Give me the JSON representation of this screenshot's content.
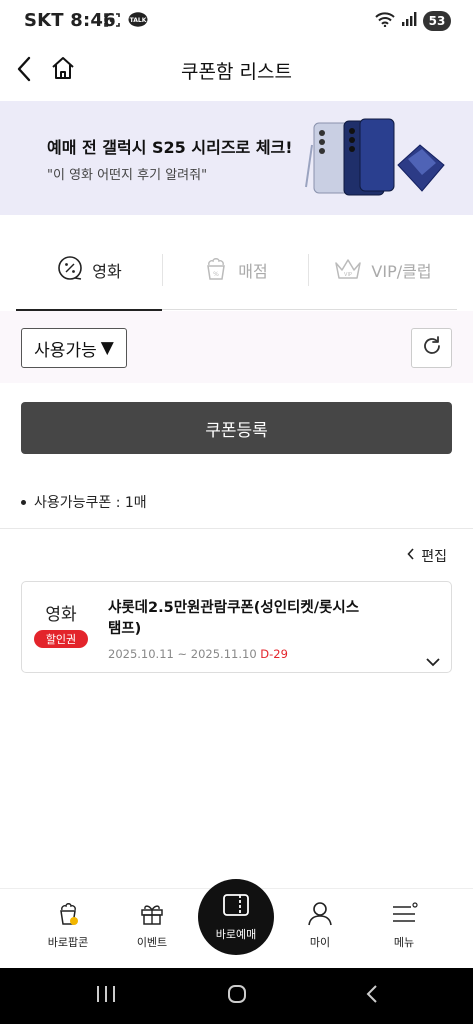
{
  "statusbar": {
    "carrier": "SKT",
    "time": "8:46",
    "talk_badge": "TALK",
    "battery": "53"
  },
  "header": {
    "title": "쿠폰함 리스트",
    "icons": [
      "back-arrow-icon",
      "home-icon"
    ]
  },
  "banner": {
    "headline": "예매 전 갤럭시 S25 시리즈로 체크!",
    "subtext": "\"이 영화 어떤지 후기 알려줘\""
  },
  "tabs": [
    {
      "label": "영화",
      "active": true,
      "icon": "movie-coupon-icon"
    },
    {
      "label": "매점",
      "active": false,
      "icon": "popcorn-icon"
    },
    {
      "label": "VIP/클럽",
      "active": false,
      "icon": "crown-icon"
    }
  ],
  "filter": {
    "status_selected": "사용가능",
    "dropdown_glyph": "▼"
  },
  "register_button": "쿠폰등록",
  "coupon_summary": {
    "label": "사용가능쿠폰 : 1매"
  },
  "edit": {
    "label": "편집"
  },
  "coupons": [
    {
      "category": "영화",
      "badge": "할인권",
      "name": "샤롯데2.5만원관람쿠폰(성인티켓/롯시스탬프)",
      "name_line1": "샤롯데2.5만원관람쿠폰(성인티켓/롯시스",
      "name_line2": "탬프)",
      "period": "2025.10.11 ~ 2025.11.10",
      "dday": "D-29"
    }
  ],
  "bottom_nav": [
    {
      "label": "바로팝콘",
      "icon": "popcorn-bucket-icon"
    },
    {
      "label": "이벤트",
      "icon": "gift-icon"
    },
    {
      "label": "바로예매",
      "icon": "ticket-icon"
    },
    {
      "label": "마이",
      "icon": "person-icon"
    },
    {
      "label": "메뉴",
      "icon": "menu-icon"
    }
  ],
  "colors": {
    "accent_red": "#e3242b",
    "banner_bg": "#ecebf8",
    "button_dark": "#464646"
  }
}
